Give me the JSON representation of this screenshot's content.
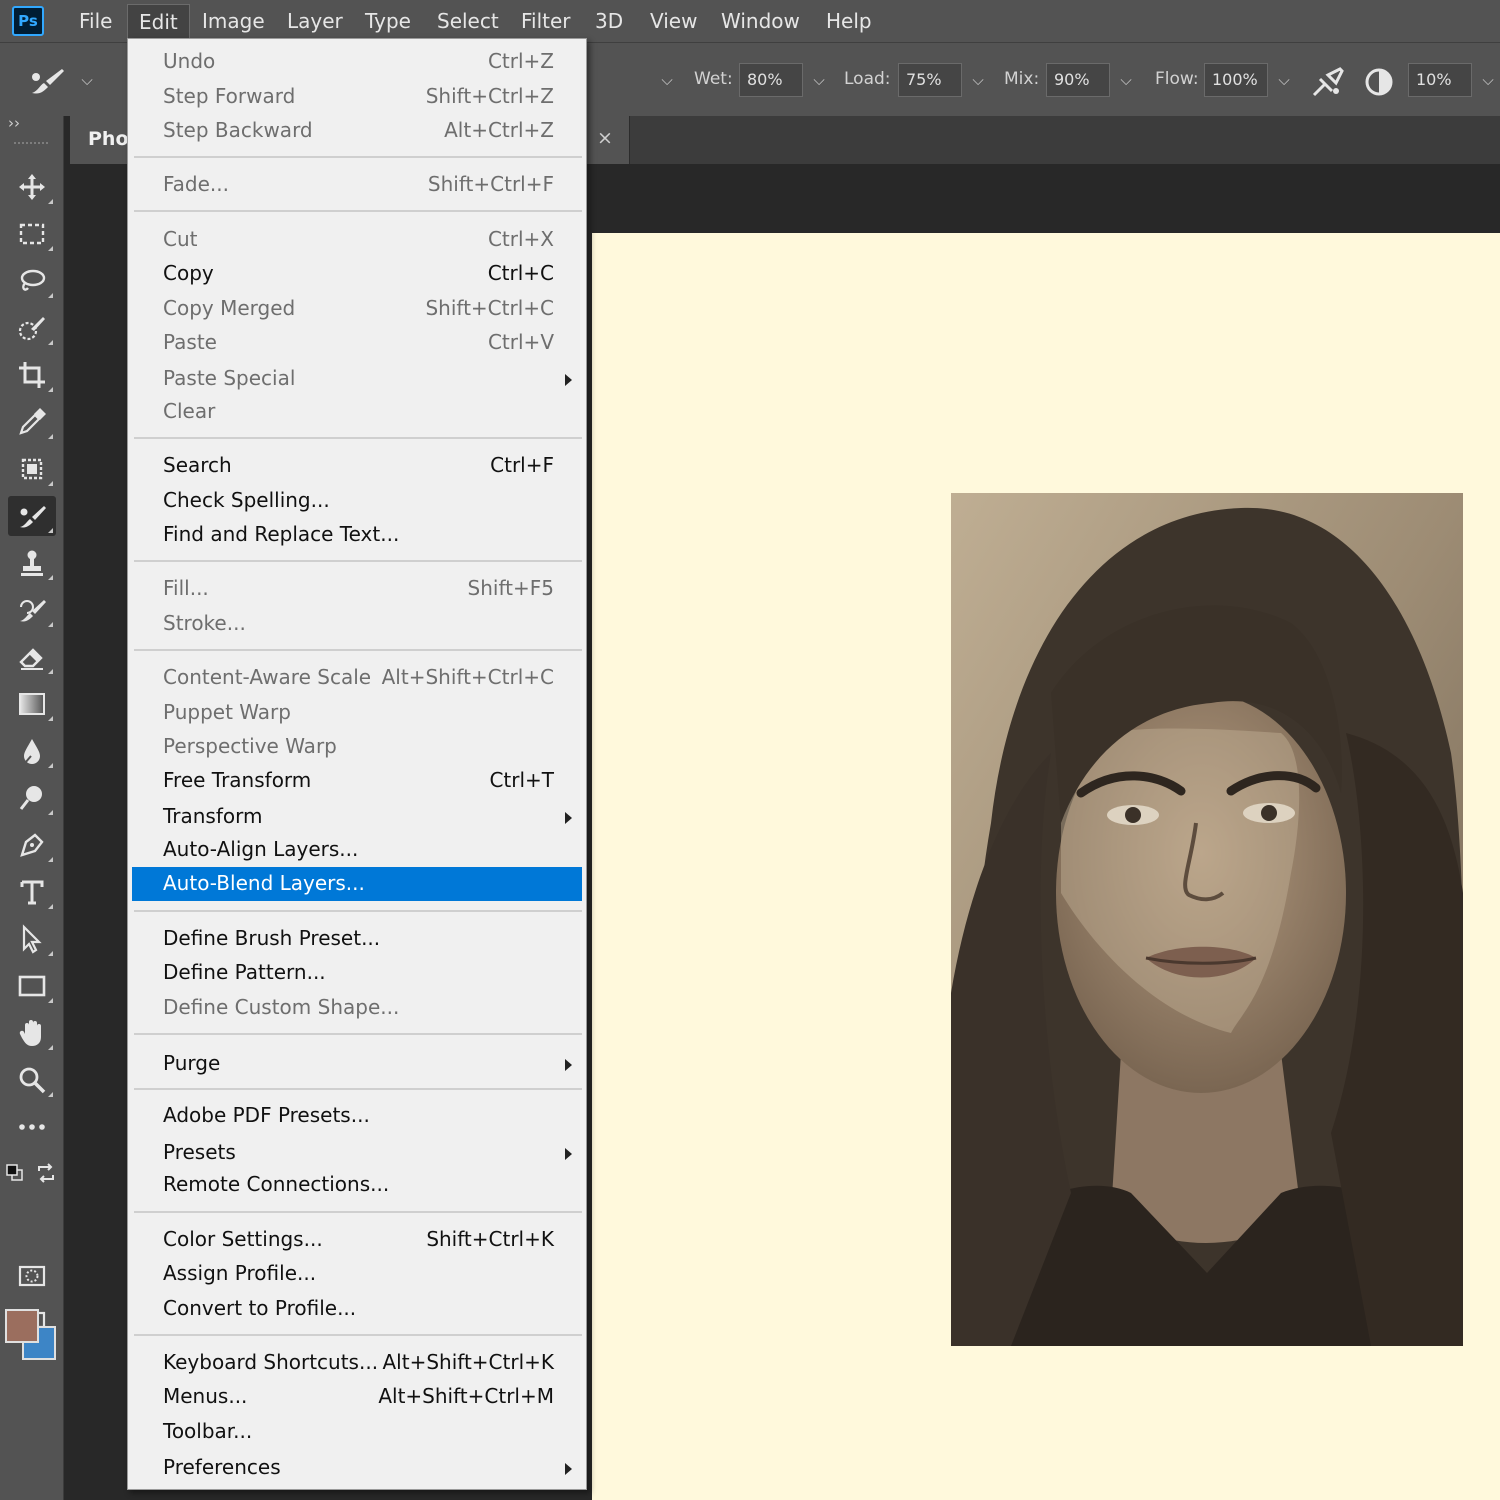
{
  "app": {
    "logo": "Ps"
  },
  "menubar": {
    "items": [
      "File",
      "Edit",
      "Image",
      "Layer",
      "Type",
      "Select",
      "Filter",
      "3D",
      "View",
      "Window",
      "Help"
    ],
    "active": "Edit"
  },
  "options": {
    "wet_label": "Wet:",
    "wet_value": "80%",
    "load_label": "Load:",
    "load_value": "75%",
    "mix_label": "Mix:",
    "mix_value": "90%",
    "flow_label": "Flow:",
    "flow_value": "100%",
    "smoothing_value": "10%",
    "dropdown_glyph": "⌵",
    "collapse_glyph": "››"
  },
  "document_tab": {
    "title": "Pho",
    "close": "×"
  },
  "colors": {
    "foreground": "#9b6e5e",
    "background": "#3d85c6",
    "highlight": "#0078d7",
    "canvas": "#fff9dc"
  },
  "tools": [
    "move-tool",
    "rectangular-marquee-tool",
    "lasso-tool",
    "quick-selection-tool",
    "crop-tool",
    "eyedropper-tool",
    "spot-healing-tool",
    "mixer-brush-tool",
    "clone-stamp-tool",
    "history-brush-tool",
    "eraser-tool",
    "gradient-tool",
    "blur-tool",
    "dodge-tool",
    "pen-tool",
    "type-tool",
    "path-selection-tool",
    "rectangle-tool",
    "hand-tool",
    "zoom-tool",
    "edit-toolbar",
    "quick-mask",
    "screen-mode"
  ],
  "edit_menu": {
    "items": [
      {
        "label": "Undo",
        "shortcut": "Ctrl+Z",
        "enabled": false
      },
      {
        "label": "Step Forward",
        "shortcut": "Shift+Ctrl+Z",
        "enabled": false
      },
      {
        "label": "Step Backward",
        "shortcut": "Alt+Ctrl+Z",
        "enabled": false
      },
      {
        "label": "Fade...",
        "shortcut": "Shift+Ctrl+F",
        "enabled": false
      },
      {
        "label": "Cut",
        "shortcut": "Ctrl+X",
        "enabled": false
      },
      {
        "label": "Copy",
        "shortcut": "Ctrl+C",
        "enabled": true
      },
      {
        "label": "Copy Merged",
        "shortcut": "Shift+Ctrl+C",
        "enabled": false
      },
      {
        "label": "Paste",
        "shortcut": "Ctrl+V",
        "enabled": false
      },
      {
        "label": "Paste Special",
        "shortcut": "",
        "enabled": false,
        "submenu": true
      },
      {
        "label": "Clear",
        "shortcut": "",
        "enabled": false
      },
      {
        "label": "Search",
        "shortcut": "Ctrl+F",
        "enabled": true
      },
      {
        "label": "Check Spelling...",
        "shortcut": "",
        "enabled": true
      },
      {
        "label": "Find and Replace Text...",
        "shortcut": "",
        "enabled": true
      },
      {
        "label": "Fill...",
        "shortcut": "Shift+F5",
        "enabled": false
      },
      {
        "label": "Stroke...",
        "shortcut": "",
        "enabled": false
      },
      {
        "label": "Content-Aware Scale",
        "shortcut": "Alt+Shift+Ctrl+C",
        "enabled": false
      },
      {
        "label": "Puppet Warp",
        "shortcut": "",
        "enabled": false
      },
      {
        "label": "Perspective Warp",
        "shortcut": "",
        "enabled": false
      },
      {
        "label": "Free Transform",
        "shortcut": "Ctrl+T",
        "enabled": true
      },
      {
        "label": "Transform",
        "shortcut": "",
        "enabled": true,
        "submenu": true
      },
      {
        "label": "Auto-Align Layers...",
        "shortcut": "",
        "enabled": true
      },
      {
        "label": "Auto-Blend Layers...",
        "shortcut": "",
        "enabled": true,
        "highlighted": true
      },
      {
        "label": "Define Brush Preset...",
        "shortcut": "",
        "enabled": true
      },
      {
        "label": "Define Pattern...",
        "shortcut": "",
        "enabled": true
      },
      {
        "label": "Define Custom Shape...",
        "shortcut": "",
        "enabled": false
      },
      {
        "label": "Purge",
        "shortcut": "",
        "enabled": true,
        "submenu": true
      },
      {
        "label": "Adobe PDF Presets...",
        "shortcut": "",
        "enabled": true
      },
      {
        "label": "Presets",
        "shortcut": "",
        "enabled": true,
        "submenu": true
      },
      {
        "label": "Remote Connections...",
        "shortcut": "",
        "enabled": true
      },
      {
        "label": "Color Settings...",
        "shortcut": "Shift+Ctrl+K",
        "enabled": true
      },
      {
        "label": "Assign Profile...",
        "shortcut": "",
        "enabled": true
      },
      {
        "label": "Convert to Profile...",
        "shortcut": "",
        "enabled": true
      },
      {
        "label": "Keyboard Shortcuts...",
        "shortcut": "Alt+Shift+Ctrl+K",
        "enabled": true
      },
      {
        "label": "Menus...",
        "shortcut": "Alt+Shift+Ctrl+M",
        "enabled": true
      },
      {
        "label": "Toolbar...",
        "shortcut": "",
        "enabled": true
      },
      {
        "label": "Preferences",
        "shortcut": "",
        "enabled": true,
        "submenu": true
      }
    ]
  }
}
